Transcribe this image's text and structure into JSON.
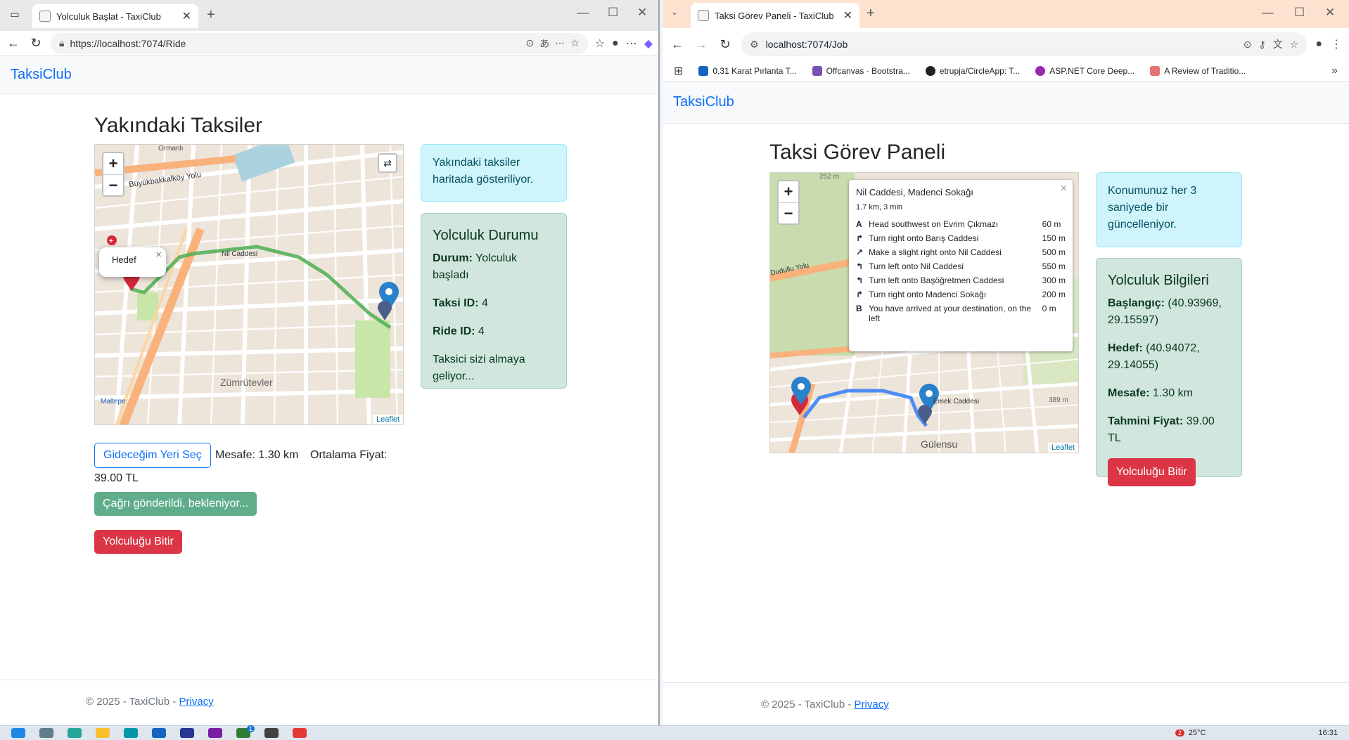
{
  "left_window": {
    "tab_title": "Yolculuk Başlat - TaxiClub",
    "url": "https://localhost:7074/Ride",
    "brand": "TaksiClub",
    "page_title": "Yakındaki Taksiler",
    "map": {
      "zoom_in": "+",
      "zoom_out": "−",
      "popup_label": "Hedef",
      "popup_close": "×",
      "attribution": "Leaflet",
      "place_label": "Zümrütevler",
      "road_label_1": "Büyükbakkalköy Yolu",
      "road_label_2": "Nil Caddesi",
      "road_label_3": "Ormanlı",
      "district_label": "Maltepe"
    },
    "info_alert": "Yakındaki taksiler haritada gösteriliyor.",
    "status_card": {
      "heading": "Yolculuk Durumu",
      "status_label": "Durum:",
      "status_value": "Yolculuk başladı",
      "taxi_label": "Taksi ID:",
      "taxi_value": "4",
      "ride_label": "Ride ID:",
      "ride_value": "4",
      "message": "Taksici sizi almaya geliyor..."
    },
    "select_destination_button": "Gideceğim Yeri Seç",
    "distance_text": "Mesafe: 1.30 km",
    "avg_price_label": "Ortalama Fiyat:",
    "avg_price_value": "39.00 TL",
    "call_sent_button": "Çağrı gönderildi, bekleniyor...",
    "end_ride_button": "Yolculuğu Bitir",
    "footer_text": "© 2025 - TaxiClub - ",
    "footer_link": "Privacy"
  },
  "right_window": {
    "tab_title": "Taksi Görev Paneli - TaxiClub",
    "url": "localhost:7074/Job",
    "bookmarks": [
      {
        "label": "0,31 Karat Pırlanta T...",
        "color": "#1565c0"
      },
      {
        "label": "Offcanvas · Bootstra...",
        "color": "#7952b3"
      },
      {
        "label": "etrupja/CircleApp: T...",
        "color": "#222222"
      },
      {
        "label": "ASP.NET Core Deep...",
        "color": "#9c27b0"
      },
      {
        "label": "A Review of Traditio...",
        "color": "#e57373"
      }
    ],
    "brand": "TaksiClub",
    "page_title": "Taksi Görev Paneli",
    "map": {
      "zoom_in": "+",
      "zoom_out": "−",
      "attribution": "Leaflet",
      "district_label": "Gülensu",
      "road_label_1": "Dudullu Yolu",
      "road_label_2": "Emek Caddesi",
      "elevation_label": "389 m",
      "scale_label": "252 m"
    },
    "route_panel": {
      "title": "Nil Caddesi, Madenci Sokağı",
      "summary": "1.7 km, 3 min",
      "close": "×",
      "steps": [
        {
          "icon": "A",
          "text": "Head southwest on Evrim Çıkmazı",
          "dist": "60 m"
        },
        {
          "icon": "↱",
          "text": "Turn right onto Barış Caddesi",
          "dist": "150 m"
        },
        {
          "icon": "↗",
          "text": "Make a slight right onto Nil Caddesi",
          "dist": "500 m"
        },
        {
          "icon": "↰",
          "text": "Turn left onto Nil Caddesi",
          "dist": "550 m"
        },
        {
          "icon": "↰",
          "text": "Turn left onto Başöğretmen Caddesi",
          "dist": "300 m"
        },
        {
          "icon": "↱",
          "text": "Turn right onto Madenci Sokağı",
          "dist": "200 m"
        },
        {
          "icon": "B",
          "text": "You have arrived at your destination, on the left",
          "dist": "0 m"
        }
      ]
    },
    "info_alert": "Konumunuz her 3 saniyede bir güncelleniyor.",
    "ride_card": {
      "heading": "Yolculuk Bilgileri",
      "start_label": "Başlangıç:",
      "start_value": "(40.93969, 29.15597)",
      "dest_label": "Hedef:",
      "dest_value": "(40.94072, 29.14055)",
      "distance_label": "Mesafe:",
      "distance_value": "1.30 km",
      "price_label": "Tahmini Fiyat:",
      "price_value": "39.00 TL",
      "end_button": "Yolculuğu Bitir"
    },
    "footer_text": "© 2025 - TaxiClub - ",
    "footer_link": "Privacy"
  },
  "taskbar": {
    "weather": "25°C",
    "time": "16:31",
    "badge_count": "2",
    "app_badge": "1"
  },
  "colors": {
    "primary": "#0d6efd",
    "danger": "#dc3545",
    "success": "#5fad8a",
    "route_green": "#4caf50",
    "route_blue": "#3b82f6"
  }
}
